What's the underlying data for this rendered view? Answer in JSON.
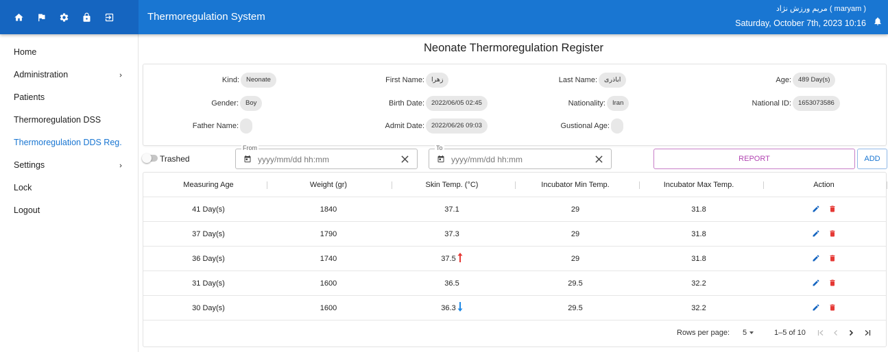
{
  "topbar": {
    "app_title": "Thermoregulation System",
    "user_name": "مریم ورزش نژاد ( maryam )",
    "datetime": "Saturday, October 7th, 2023 10:16",
    "icons": [
      "home-icon",
      "flag-icon",
      "gear-icon",
      "lock-icon",
      "logout-icon"
    ],
    "accent_color": "#1976d2"
  },
  "sidebar": {
    "items": [
      {
        "label": "Home",
        "has_submenu": false
      },
      {
        "label": "Administration",
        "has_submenu": true
      },
      {
        "label": "Patients",
        "has_submenu": false
      },
      {
        "label": "Thermoregulation DSS",
        "has_submenu": false
      },
      {
        "label": "Thermoregulation DDS Reg.",
        "has_submenu": false,
        "active": true
      },
      {
        "label": "Settings",
        "has_submenu": true
      },
      {
        "label": "Lock",
        "has_submenu": false
      },
      {
        "label": "Logout",
        "has_submenu": false
      }
    ]
  },
  "page": {
    "title": "Neonate Thermoregulation Register"
  },
  "patient": {
    "kind_label": "Kind:",
    "kind": "Neonate",
    "first_name_label": "First Name:",
    "first_name": "زهرا",
    "last_name_label": "Last Name:",
    "last_name": "اباذری",
    "age_label": "Age:",
    "age": "489 Day(s)",
    "gender_label": "Gender:",
    "gender": "Boy",
    "birth_date_label": "Birth Date:",
    "birth_date": "2022/06/05 02:45",
    "nationality_label": "Nationality:",
    "nationality": "Iran",
    "national_id_label": "National ID:",
    "national_id": "1653073586",
    "father_name_label": "Father Name:",
    "father_name": "",
    "admit_date_label": "Admit Date:",
    "admit_date": "2022/06/26 09:03",
    "gestational_age_label": "Gustional Age:",
    "gestational_age": ""
  },
  "filters": {
    "trashed_label": "Trashed",
    "trashed_on": false,
    "from_label": "From",
    "from_placeholder": "yyyy/mm/dd hh:mm",
    "to_label": "To",
    "to_placeholder": "yyyy/mm/dd hh:mm",
    "report_label": "REPORT",
    "add_label": "ADD"
  },
  "table": {
    "headers": [
      "Measuring Age",
      "Weight (gr)",
      "Skin Temp. (°C)",
      "Incubator Min Temp.",
      "Incubator Max Temp.",
      "Action"
    ],
    "rows": [
      {
        "age": "41 Day(s)",
        "weight": "1840",
        "skin_temp": "37.1",
        "trend": "",
        "min_temp": "29",
        "max_temp": "31.8"
      },
      {
        "age": "37 Day(s)",
        "weight": "1790",
        "skin_temp": "37.3",
        "trend": "",
        "min_temp": "29",
        "max_temp": "31.8"
      },
      {
        "age": "36 Day(s)",
        "weight": "1740",
        "skin_temp": "37.5",
        "trend": "up",
        "min_temp": "29",
        "max_temp": "31.8"
      },
      {
        "age": "31 Day(s)",
        "weight": "1600",
        "skin_temp": "36.5",
        "trend": "",
        "min_temp": "29.5",
        "max_temp": "32.2"
      },
      {
        "age": "30 Day(s)",
        "weight": "1600",
        "skin_temp": "36.3",
        "trend": "down",
        "min_temp": "29.5",
        "max_temp": "32.2"
      }
    ],
    "trend_colors": {
      "up": "#e53935",
      "down": "#1e88e5"
    },
    "action_icons": [
      "edit-icon",
      "delete-icon"
    ],
    "edit_color": "#1565c0",
    "delete_color": "#e53935"
  },
  "pagination": {
    "rows_per_page_label": "Rows per page:",
    "rows_per_page": "5",
    "range": "1–5 of 10"
  }
}
